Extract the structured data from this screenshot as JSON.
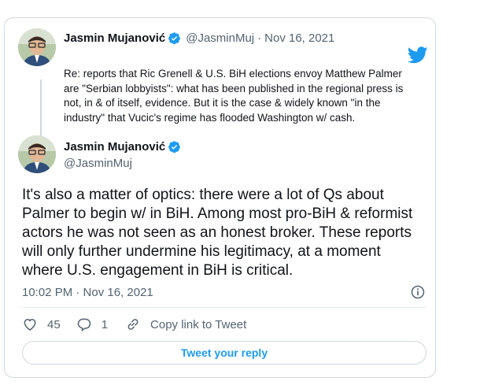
{
  "reply_tweet": {
    "name": "Jasmin Mujanović",
    "handle": "@JasminMuj",
    "separator": "·",
    "date": "Nov 16, 2021",
    "text": "Re: reports that Ric Grenell & U.S. BiH elections envoy Matthew Palmer are \"Serbian lobbyists\": what has been published in the regional press is not, in & of itself, evidence. But it is the case & widely known \"in the industry\" that Vucic's regime has flooded Washington w/ cash."
  },
  "main_tweet": {
    "name": "Jasmin Mujanović",
    "handle": "@JasminMuj",
    "text": "It's also a matter of optics: there were a lot of Qs about Palmer to begin w/ in BiH. Among most pro-BiH & reformist actors he was not seen as an honest broker. These reports will only further undermine his legitimacy, at a moment where U.S. engagement in BiH is critical.",
    "timestamp": "10:02 PM · Nov 16, 2021"
  },
  "actions": {
    "likes": "45",
    "replies": "1",
    "copy_link": "Copy link to Tweet"
  },
  "reply_button": "Tweet your reply",
  "icons": {
    "brand": "twitter-bird-icon",
    "verified": "verified-badge-icon",
    "info": "info-icon",
    "like": "heart-icon",
    "reply": "reply-bubble-icon",
    "link": "link-icon"
  },
  "colors": {
    "accent": "#1d9bf0",
    "text": "#0f1419",
    "muted": "#536471",
    "border": "#cfd9de"
  }
}
